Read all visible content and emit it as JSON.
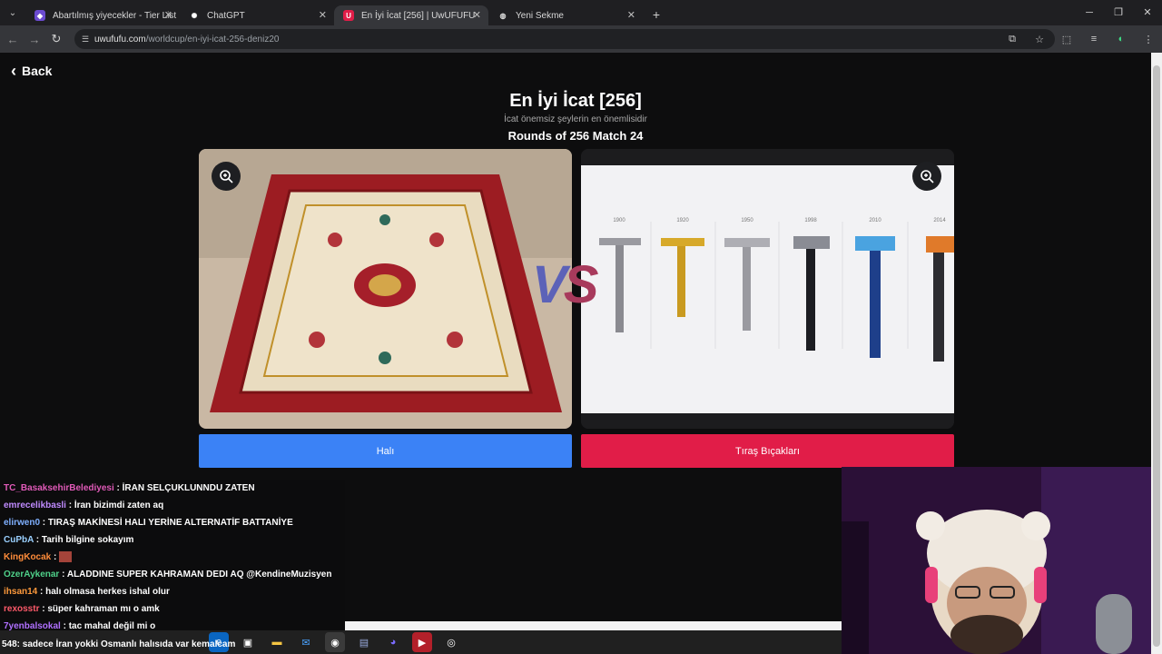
{
  "browser": {
    "tabs": [
      {
        "label": "Abartılmış yiyecekler - Tier List",
        "active": false
      },
      {
        "label": "ChatGPT",
        "active": false
      },
      {
        "label": "En İyi İcat [256] | UwUFUFU",
        "active": true
      },
      {
        "label": "Yeni Sekme",
        "active": false
      }
    ],
    "url_host": "uwufufu.com",
    "url_path": "/worldcup/en-iyi-icat-256-deniz20"
  },
  "page": {
    "back_label": "Back",
    "title": "En İyi İcat [256]",
    "subtitle": "İcat önemsiz şeylerin en önemlisidir",
    "round_info": "Rounds of 256 Match 24",
    "vs_label": "VS",
    "left_choice": "Halı",
    "right_choice": "Tıraş Bıçakları",
    "razor_years": [
      "1900",
      "1920",
      "1950",
      "1998",
      "2010",
      "2014"
    ]
  },
  "chat": [
    {
      "user": "TC_BasaksehirBelediyesi",
      "color": "#e05ab8",
      "msg": "İRAN SELÇUKLUNNDU ZATEN"
    },
    {
      "user": "emrecelikbasli",
      "color": "#c08bff",
      "msg": "İran bizimdi zaten aq"
    },
    {
      "user": "elirwen0",
      "color": "#7fb0ff",
      "msg": "TIRAŞ MAKİNESİ HALI YERİNE ALTERNATİF BATTANİYE"
    },
    {
      "user": "CuPbA",
      "color": "#9ad0ff",
      "msg": "Tarih bilgine sokayım"
    },
    {
      "user": "KingKocak",
      "color": "#ff8c3a",
      "msg": ""
    },
    {
      "user": "OzerAykenar",
      "color": "#4fd18a",
      "msg": "ALADDINE SUPER KAHRAMAN DEDI AQ @KendineMuzisyen"
    },
    {
      "user": "ihsan14",
      "color": "#ff9a3c",
      "msg": "halı olmasa herkes ishal olur"
    },
    {
      "user": "rexosstr",
      "color": "#ff5a6a",
      "msg": "süper kahraman mı o amk"
    },
    {
      "user": "7yenbalsokal",
      "color": "#b070ff",
      "msg": "tac mahal değil mi o"
    }
  ],
  "ticker": "548: sadece İran yokki Osmanlı halısıda var kemalcam",
  "colors": {
    "left": "#3b82f6",
    "right": "#e11d48"
  }
}
